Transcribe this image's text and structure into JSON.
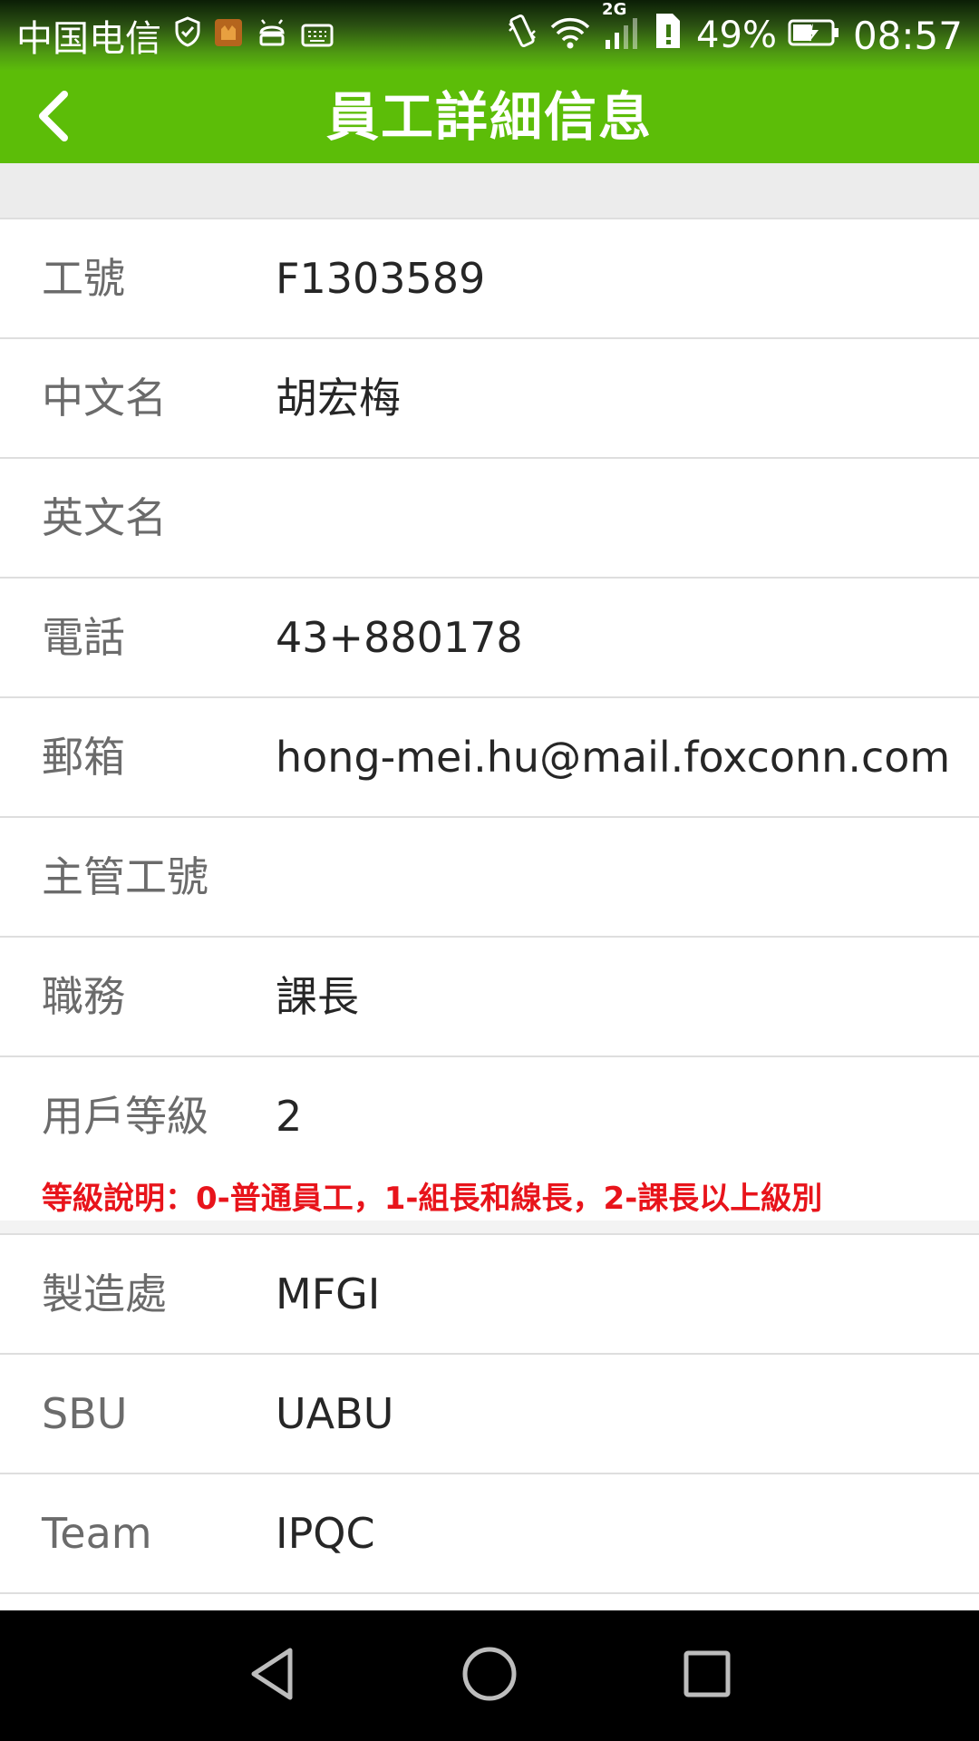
{
  "status_bar": {
    "carrier": "中国电信",
    "network_label": "2G",
    "battery_percent": "49%",
    "time": "08:57"
  },
  "header": {
    "title": "員工詳細信息",
    "back_icon": "chevron-left-icon"
  },
  "fields": [
    {
      "label": "工號",
      "value": "F1303589"
    },
    {
      "label": "中文名",
      "value": "胡宏梅"
    },
    {
      "label": "英文名",
      "value": ""
    },
    {
      "label": "電話",
      "value": "43+880178"
    },
    {
      "label": "郵箱",
      "value": "hong-mei.hu@mail.foxconn.com"
    },
    {
      "label": "主管工號",
      "value": ""
    },
    {
      "label": "職務",
      "value": "課長"
    },
    {
      "label": "用戶等級",
      "value": "2"
    },
    {
      "label": "製造處",
      "value": "MFGI"
    },
    {
      "label": "SBU",
      "value": "UABU"
    },
    {
      "label": "Team",
      "value": "IPQC"
    }
  ],
  "grade_note": "等級說明：0-普通員工，1-組長和線長，2-課長以上級別",
  "colors": {
    "accent": "#5cbd08",
    "note_red": "#e8141b",
    "label_gray": "#6b6b6b",
    "value_dark": "#262626"
  },
  "nav_icons": [
    "back-triangle-icon",
    "home-circle-icon",
    "recents-square-icon"
  ]
}
